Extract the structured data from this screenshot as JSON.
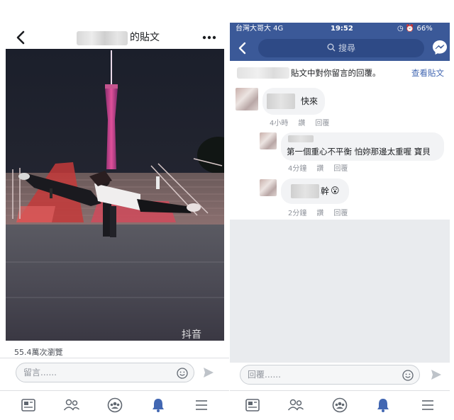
{
  "left": {
    "header": {
      "title_suffix": "的貼文"
    },
    "video_caption": "抖音",
    "views": "55.4萬次瀏覽",
    "comment_input": {
      "placeholder": "留言......"
    }
  },
  "right": {
    "status_bar": {
      "carrier": "台灣大哥大  4G",
      "time": "19:52",
      "battery": "◷ ⏰ 66%"
    },
    "search": {
      "placeholder": "搜尋"
    },
    "notice": {
      "text": "貼文中對你留言的回覆。",
      "link": "查看貼文"
    },
    "comments": [
      {
        "text": "快來",
        "time": "4小時",
        "like": "讚",
        "reply": "回覆"
      },
      {
        "text": "第一個重心不平衡  怕妳那邊太重喔 寶貝",
        "time": "4分鐘",
        "like": "讚",
        "reply": "回覆"
      },
      {
        "text": "幹",
        "emoji": "😮",
        "time": "2分鐘",
        "like": "讚",
        "reply": "回覆"
      }
    ],
    "reply_input": {
      "placeholder": "回覆......"
    }
  },
  "tabbar": {
    "icons": [
      "news-feed-icon",
      "friends-icon",
      "groups-icon",
      "notifications-icon",
      "menu-icon"
    ]
  },
  "colors": {
    "facebook_blue": "#3b5998",
    "link_blue": "#4267b2",
    "bubble_gray": "#f2f3f5",
    "bg_gray": "#e9ebee"
  }
}
